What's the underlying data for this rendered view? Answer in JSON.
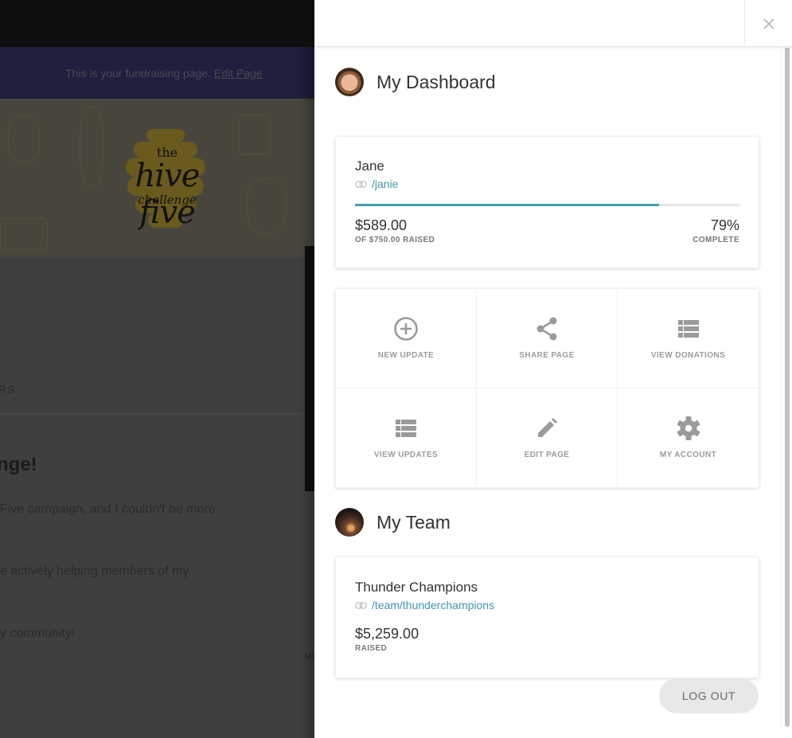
{
  "background_page": {
    "banner_text": "This is your fundraising page.",
    "banner_link": "Edit Page",
    "logo": {
      "top": "the",
      "main": "hive five",
      "sub": "challenge"
    },
    "tab_fragment": "RS",
    "heading_fragment": "nge!",
    "paragraph_lines": [
      " Five campaign, and I couldn't be more",
      "e actively helping members of my",
      "y community!"
    ],
    "side_label_fragment": "MY"
  },
  "drawer": {
    "close_icon": "close-icon",
    "dashboard": {
      "title": "My Dashboard",
      "avatar": "user-avatar",
      "fundraiser": {
        "name": "Jane",
        "link_icon": "link-icon",
        "link": "/janie",
        "raised": "$589.00",
        "goal_label": "OF $750.00 RAISED",
        "percent": "79%",
        "percent_value": 0.79,
        "percent_label": "COMPLETE"
      },
      "actions": [
        {
          "label": "NEW UPDATE",
          "icon": "plus-circle-icon"
        },
        {
          "label": "SHARE PAGE",
          "icon": "share-icon"
        },
        {
          "label": "VIEW DONATIONS",
          "icon": "list-icon"
        },
        {
          "label": "VIEW UPDATES",
          "icon": "list-icon"
        },
        {
          "label": "EDIT PAGE",
          "icon": "pencil-icon"
        },
        {
          "label": "MY ACCOUNT",
          "icon": "gear-icon"
        }
      ]
    },
    "team": {
      "title": "My Team",
      "avatar": "team-avatar",
      "name": "Thunder Champions",
      "link": "/team/thunderchampions",
      "raised": "$5,259.00",
      "raised_label": "RAISED"
    },
    "logout_label": "LOG OUT"
  },
  "colors": {
    "accent": "#45a0b3",
    "link": "#4197ac",
    "icon_gray": "#9b9b9b",
    "banner_bg": "#1f1e3c"
  }
}
